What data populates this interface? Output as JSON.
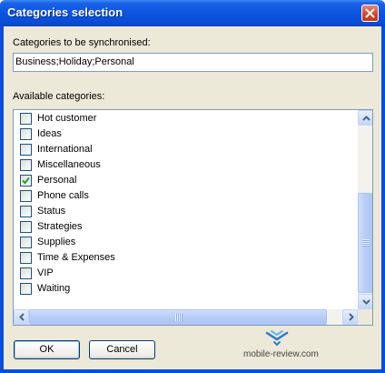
{
  "window": {
    "title": "Categories selection"
  },
  "sync": {
    "label": "Categories to be synchronised:",
    "value": "Business;Holiday;Personal"
  },
  "available": {
    "label": "Available categories:",
    "items": [
      {
        "label": "Hot customer",
        "checked": false
      },
      {
        "label": "Ideas",
        "checked": false
      },
      {
        "label": "International",
        "checked": false
      },
      {
        "label": "Miscellaneous",
        "checked": false
      },
      {
        "label": "Personal",
        "checked": true
      },
      {
        "label": "Phone calls",
        "checked": false
      },
      {
        "label": "Status",
        "checked": false
      },
      {
        "label": "Strategies",
        "checked": false
      },
      {
        "label": "Supplies",
        "checked": false
      },
      {
        "label": "Time & Expenses",
        "checked": false
      },
      {
        "label": "VIP",
        "checked": false
      },
      {
        "label": "Waiting",
        "checked": false
      }
    ]
  },
  "buttons": {
    "ok": "OK",
    "cancel": "Cancel"
  },
  "watermark": {
    "text": "mobile-review.com"
  },
  "icons": {
    "close": "close-icon",
    "check": "check-icon"
  },
  "colors": {
    "titlebar": "#0b55e0",
    "close": "#d24a2c",
    "check": "#21a121"
  }
}
